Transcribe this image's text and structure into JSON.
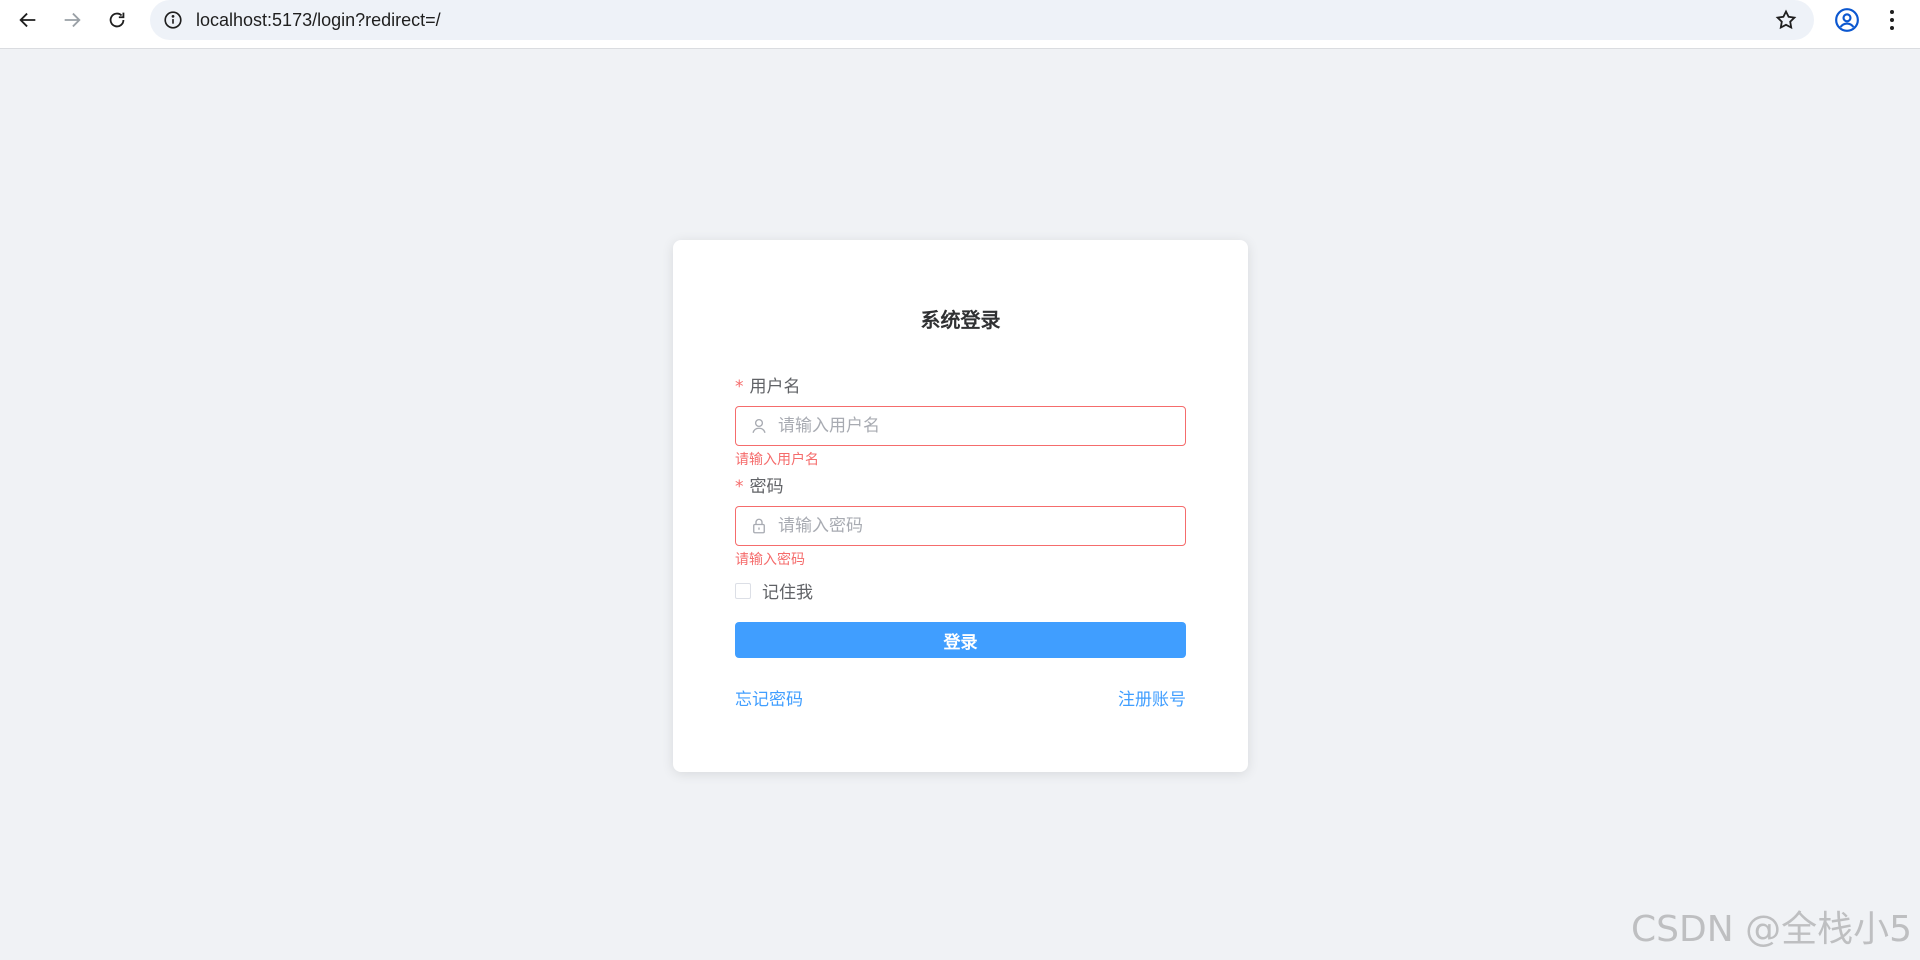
{
  "browser": {
    "url": "localhost:5173/login?redirect=/",
    "icons": [
      "back-icon",
      "forward-icon",
      "reload-icon",
      "site-info-icon",
      "bookmark-star-icon",
      "profile-icon",
      "menu-dots-icon"
    ]
  },
  "login": {
    "title": "系统登录",
    "required_mark": "*",
    "username": {
      "label": "用户名",
      "placeholder": "请输入用户名",
      "value": "",
      "error": "请输入用户名",
      "icon": "user-icon"
    },
    "password": {
      "label": "密码",
      "placeholder": "请输入密码",
      "value": "",
      "error": "请输入密码",
      "icon": "lock-icon"
    },
    "remember_label": "记住我",
    "remember_checked": false,
    "submit_label": "登录",
    "forgot_label": "忘记密码",
    "register_label": "注册账号"
  },
  "colors": {
    "page_bg": "#f0f2f5",
    "primary": "#409eff",
    "error": "#f56c6c"
  },
  "watermark": "CSDN @全栈小5"
}
